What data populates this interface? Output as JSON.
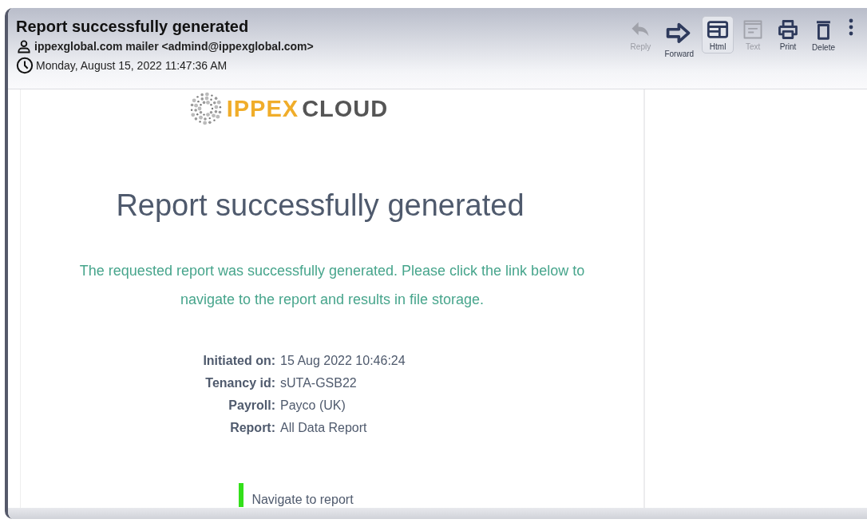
{
  "header": {
    "subject": "Report successfully generated",
    "sender": "ippexglobal.com mailer <admind@ippexglobal.com>",
    "date": "Monday, August 15, 2022 11:47:36 AM"
  },
  "toolbar": [
    {
      "kind": "reply",
      "label": "Reply",
      "disabled": true,
      "selected": false
    },
    {
      "kind": "forward",
      "label": "Forward",
      "disabled": false,
      "selected": false
    },
    {
      "kind": "html",
      "label": "Html",
      "disabled": false,
      "selected": true
    },
    {
      "kind": "text",
      "label": "Text",
      "disabled": true,
      "selected": false
    },
    {
      "kind": "print",
      "label": "Print",
      "disabled": false,
      "selected": false
    },
    {
      "kind": "delete",
      "label": "Delete",
      "disabled": false,
      "selected": false
    },
    {
      "kind": "more",
      "disabled": false,
      "selected": false
    }
  ],
  "body": {
    "logo": {
      "brand": "IPPEX",
      "product": "CLOUD"
    },
    "title": "Report successfully generated",
    "message": "The requested report was successfully generated. Please click the link below to navigate to the report and results in file storage.",
    "details": [
      {
        "label": "Initiated on:",
        "value": "15 Aug 2022 10:46:24"
      },
      {
        "label": "Tenancy id:",
        "value": "sUTA-GSB22"
      },
      {
        "label": "Payroll:",
        "value": "Payco (UK)"
      },
      {
        "label": "Report:",
        "value": "All Data Report"
      }
    ],
    "link": "Navigate to report"
  }
}
